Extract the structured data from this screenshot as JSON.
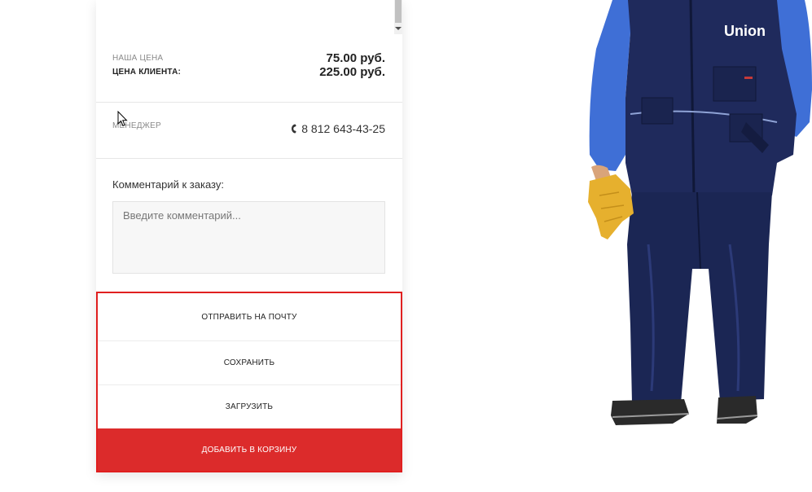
{
  "prices": {
    "our_price_label": "НАША ЦЕНА",
    "our_price_value": "75.00 руб.",
    "client_price_label": "ЦЕНА КЛИЕНТА:",
    "client_price_value": "225.00 руб."
  },
  "manager": {
    "label": "МЕНЕДЖЕР",
    "phone": "8 812 643-43-25",
    "icon": "phone-icon"
  },
  "comment": {
    "label": "Комментарий к заказу:",
    "placeholder": "Введите комментарий...",
    "value": ""
  },
  "actions": {
    "send_email": "ОТПРАВИТЬ НА ПОЧТУ",
    "save": "СОХРАНИТЬ",
    "load": "ЗАГРУЗИТЬ",
    "add_to_cart": "ДОБАВИТЬ В КОРЗИНУ"
  },
  "product": {
    "brand": "Union"
  },
  "colors": {
    "accent_red": "#dc2b2b",
    "border_red": "#e01f1f",
    "jacket_navy": "#1f2a5c",
    "jacket_blue": "#3f6fd6"
  }
}
